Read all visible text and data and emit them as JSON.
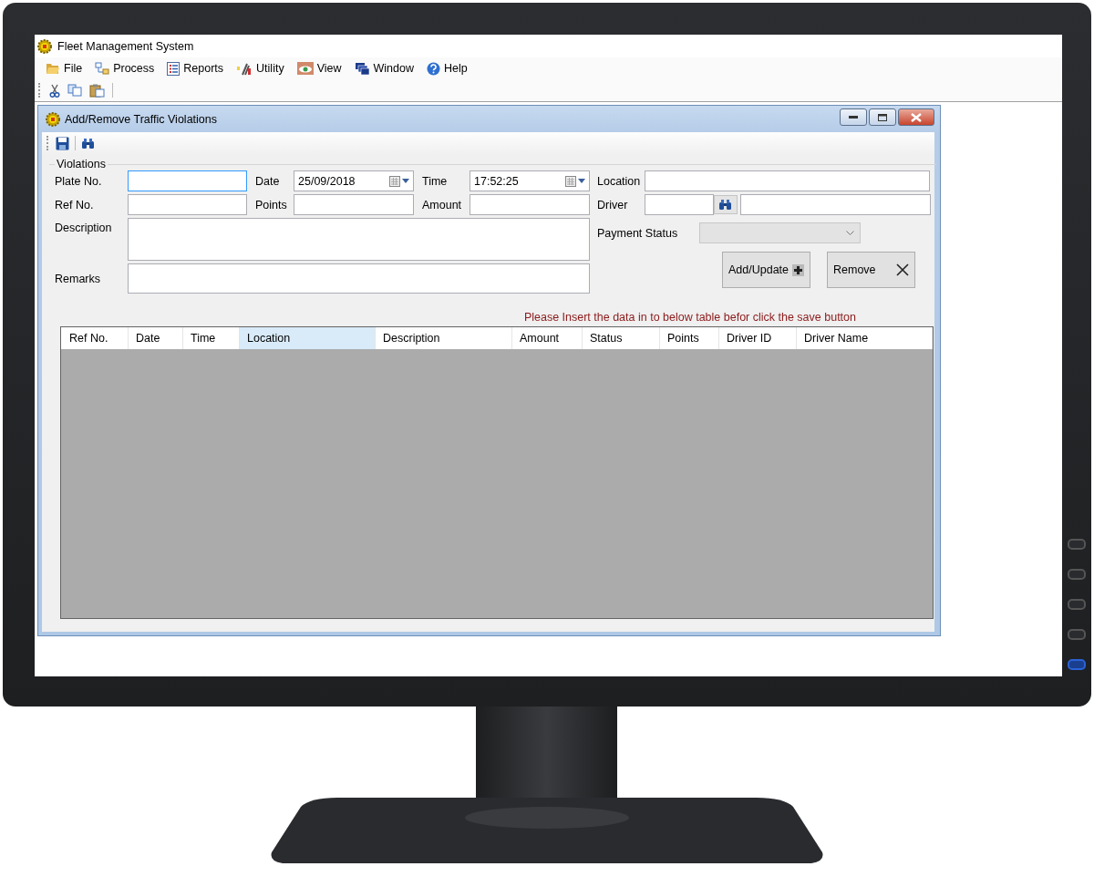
{
  "app": {
    "title": "Fleet Management System"
  },
  "menu": [
    {
      "kind": "file",
      "label": "File"
    },
    {
      "kind": "process",
      "label": "Process"
    },
    {
      "kind": "reports",
      "label": "Reports"
    },
    {
      "kind": "utility",
      "label": "Utility"
    },
    {
      "kind": "view",
      "label": "View"
    },
    {
      "kind": "window",
      "label": "Window"
    },
    {
      "kind": "help",
      "label": "Help"
    }
  ],
  "toolbar": [
    {
      "kind": "cut"
    },
    {
      "kind": "copy"
    },
    {
      "kind": "paste"
    }
  ],
  "child_window": {
    "title": "Add/Remove Traffic Violations",
    "toolbar": [
      {
        "kind": "save"
      },
      {
        "kind": "find"
      }
    ],
    "group_title": "Violations",
    "form": {
      "plate_no": {
        "label": "Plate No.",
        "focused": true
      },
      "date": {
        "label": "Date",
        "value": "25/09/2018"
      },
      "time": {
        "label": "Time",
        "value": "17:52:25"
      },
      "ref_no": {
        "label": "Ref No.",
        "focused": false
      },
      "points": {
        "label": "Points",
        "focused": false
      },
      "amount": {
        "label": "Amount",
        "focused": false
      },
      "description": {
        "label": "Description"
      },
      "remarks": {
        "label": "Remarks"
      },
      "location": {
        "label": "Location",
        "focused": false
      },
      "driver": {
        "label": "Driver"
      },
      "payment_status": {
        "label": "Payment Status",
        "disabled": true
      }
    },
    "buttons": [
      {
        "kind": "add",
        "label": "Add/Update"
      },
      {
        "kind": "remove",
        "label": "Remove"
      }
    ],
    "message": "Please Insert the data in to below table befor click the save button",
    "table": {
      "columns": [
        {
          "label": "Ref No.",
          "selected": false
        },
        {
          "label": "Date",
          "selected": false
        },
        {
          "label": "Time",
          "selected": false
        },
        {
          "label": "Location",
          "selected": true
        },
        {
          "label": "Description",
          "selected": false
        },
        {
          "label": "Amount",
          "selected": false
        },
        {
          "label": "Status",
          "selected": false
        },
        {
          "label": "Points",
          "selected": false
        },
        {
          "label": "Driver ID",
          "selected": false
        },
        {
          "label": "Driver Name",
          "selected": false
        }
      ]
    }
  }
}
